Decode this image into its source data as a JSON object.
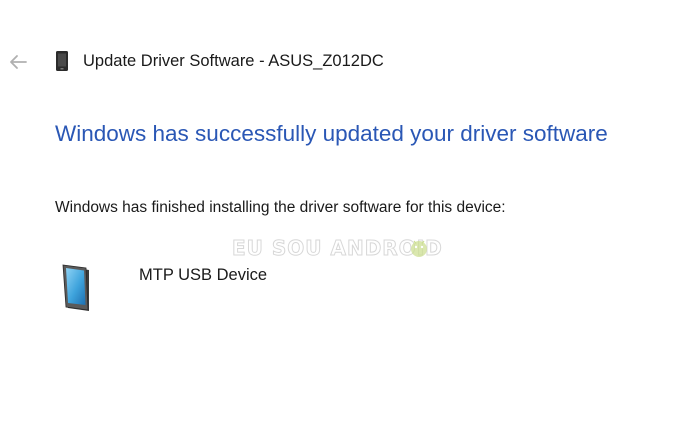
{
  "window": {
    "title": "Update Driver Software - ASUS_Z012DC",
    "back_icon": "back-arrow-icon",
    "device_icon": "phone-icon"
  },
  "main": {
    "heading": "Windows has successfully updated your driver software",
    "message": "Windows has finished installing the driver software for this device:",
    "device": {
      "name": "MTP USB Device",
      "icon": "phone-icon"
    }
  },
  "watermark": {
    "text": "EU SOU ANDROID",
    "icon": "android-logo-icon"
  },
  "colors": {
    "heading": "#2a57b5",
    "text": "#1a1a1a",
    "back_arrow": "#b0b0b0",
    "background": "#ffffff"
  }
}
